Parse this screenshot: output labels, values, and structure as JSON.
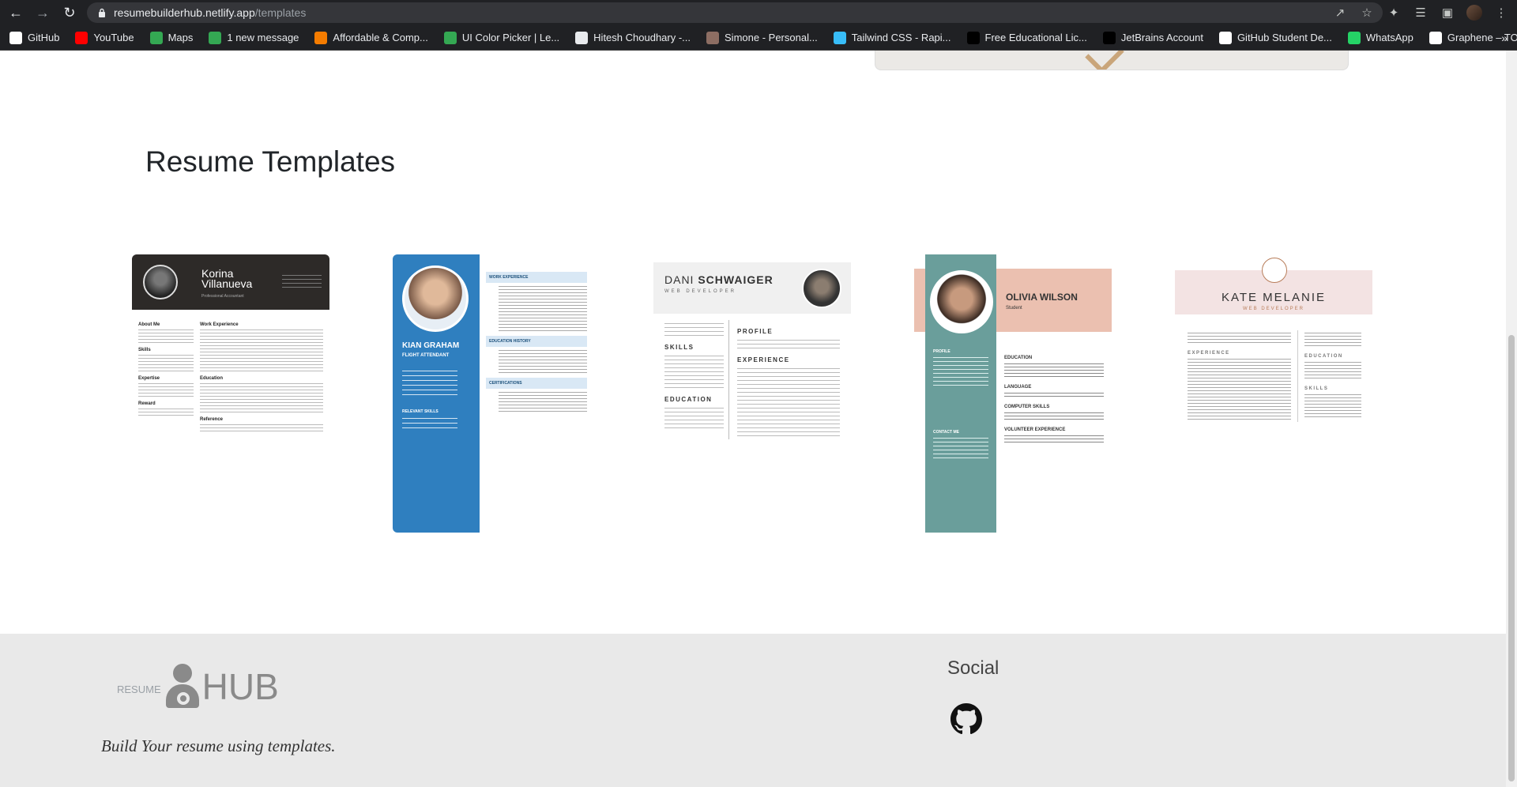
{
  "browser": {
    "url_host": "resumebuilderhub.netlify.app",
    "url_path": "/templates",
    "bookmarks": [
      {
        "label": "GitHub",
        "icon": "github-icon",
        "color": "#ffffff"
      },
      {
        "label": "YouTube",
        "icon": "youtube-icon",
        "color": "#ff0000"
      },
      {
        "label": "Maps",
        "icon": "maps-icon",
        "color": "#34a853"
      },
      {
        "label": "1 new message",
        "icon": "chat-icon",
        "color": "#34a853"
      },
      {
        "label": "Affordable & Comp...",
        "icon": "orange-circle-icon",
        "color": "#f57c00"
      },
      {
        "label": "UI Color Picker | Le...",
        "icon": "picker-icon",
        "color": "#34a853"
      },
      {
        "label": "Hitesh Choudhary -...",
        "icon": "bookmark-icon",
        "color": "#e8eaed"
      },
      {
        "label": "Simone - Personal...",
        "icon": "simone-icon",
        "color": "#8d6e63"
      },
      {
        "label": "Tailwind CSS - Rapi...",
        "icon": "tailwind-icon",
        "color": "#38bdf8"
      },
      {
        "label": "Free Educational Lic...",
        "icon": "black-square-icon",
        "color": "#000000"
      },
      {
        "label": "JetBrains Account",
        "icon": "jetbrains-icon",
        "color": "#000000"
      },
      {
        "label": "GitHub Student De...",
        "icon": "github-icon",
        "color": "#ffffff"
      },
      {
        "label": "WhatsApp",
        "icon": "whatsapp-icon",
        "color": "#25d366"
      },
      {
        "label": "Graphene – TOTEM",
        "icon": "graphene-icon",
        "color": "#ffffff"
      }
    ],
    "more": "»"
  },
  "page": {
    "section_title": "Resume Templates"
  },
  "templates": [
    {
      "name_first": "Korina",
      "name_last": "Villanueva",
      "role": "Professional Accountant",
      "sections_left": [
        "About Me",
        "Skills",
        "Expertise",
        "Reward"
      ],
      "sections_right": [
        "Work Experience",
        "Education",
        "Reference"
      ]
    },
    {
      "name": "KIAN GRAHAM",
      "role": "FLIGHT ATTENDANT",
      "sections_left": [
        "RELEVANT SKILLS"
      ],
      "sections_right": [
        "WORK EXPERIENCE",
        "EDUCATION HISTORY",
        "CERTIFICATIONS"
      ]
    },
    {
      "name_first": "DANI",
      "name_last": "SCHWAIGER",
      "role": "WEB DEVELOPER",
      "sections_left": [
        "SKILLS",
        "EDUCATION"
      ],
      "sections_right": [
        "PROFILE",
        "EXPERIENCE"
      ]
    },
    {
      "name": "OLIVIA WILSON",
      "role": "Student",
      "sections_left": [
        "PROFILE",
        "CONTACT ME"
      ],
      "sections_right": [
        "EDUCATION",
        "LANGUAGE",
        "COMPUTER SKILLS",
        "VOLUNTEER EXPERIENCE"
      ]
    },
    {
      "name": "KATE MELANIE",
      "role": "WEB DEVELOPER",
      "sections_left": [
        "EXPERIENCE"
      ],
      "sections_right": [
        "EDUCATION",
        "SKILLS"
      ]
    }
  ],
  "footer": {
    "brand_small": "RESUME",
    "brand_big": "HUB",
    "tagline": "Build Your resume using templates.",
    "social_title": "Social"
  }
}
